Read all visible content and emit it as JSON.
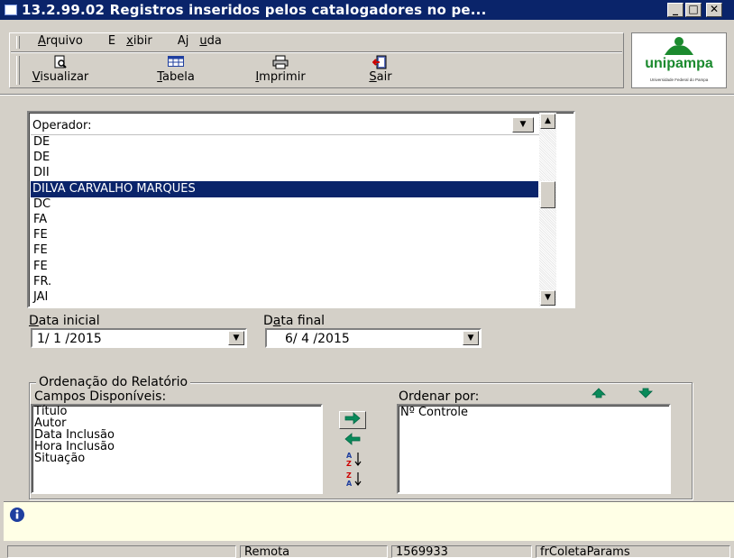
{
  "window": {
    "title": "13.2.99.02 Registros inseridos pelos catalogadores no pe...",
    "min_glyph": "_",
    "max_glyph": "□",
    "close_glyph": "✕"
  },
  "menu": {
    "arquivo": {
      "pre": "",
      "u": "A",
      "post": "rquivo"
    },
    "exibir": {
      "pre": "E",
      "u": "x",
      "post": "ibir"
    },
    "ajuda": {
      "pre": "Aj",
      "u": "u",
      "post": "da"
    }
  },
  "toolbar": {
    "visualizar": {
      "pre": "",
      "u": "V",
      "post": "isualizar"
    },
    "tabela": {
      "pre": "",
      "u": "T",
      "post": "abela"
    },
    "imprimir": {
      "pre": "",
      "u": "I",
      "post": "mprimir"
    },
    "sair": {
      "pre": "",
      "u": "S",
      "post": "air"
    }
  },
  "logo": {
    "name": "unipampa",
    "sub": "Universidade Federal do Pampa",
    "color": "#1b8a2e"
  },
  "operador": {
    "header": "Operador:",
    "items": [
      "DE",
      "DE",
      "DII",
      "DILVA CARVALHO MARQUES",
      "DC",
      "FA",
      "FE",
      "FE",
      "FE",
      "FR.",
      "JAI"
    ],
    "selected_index": 3
  },
  "dates": {
    "inicial_label": {
      "pre": "",
      "u": "D",
      "post": "ata inicial"
    },
    "inicial_value": "1/ 1 /2015",
    "final_label": {
      "pre": "D",
      "u": "a",
      "post": "ta final"
    },
    "final_value": "6/ 4 /2015"
  },
  "ordenacao": {
    "group_label": "Ordenação do Relatório",
    "disponiveis_label": "Campos Disponíveis:",
    "disponiveis": [
      "Título",
      "Autor",
      "Data Inclusão",
      "Hora Inclusão",
      "Situação"
    ],
    "ordenar_label": "Ordenar por:",
    "ordenar": [
      "Nº Controle"
    ]
  },
  "info_icon": "info-icon",
  "status": {
    "p2": "Remota",
    "p3": "1569933",
    "p4": "frColetaParams"
  },
  "colors": {
    "titlebar": "#0a246a",
    "face": "#d4d0c8",
    "info_panel": "#ffffe6",
    "arrow_green": "#0a8a5a"
  }
}
